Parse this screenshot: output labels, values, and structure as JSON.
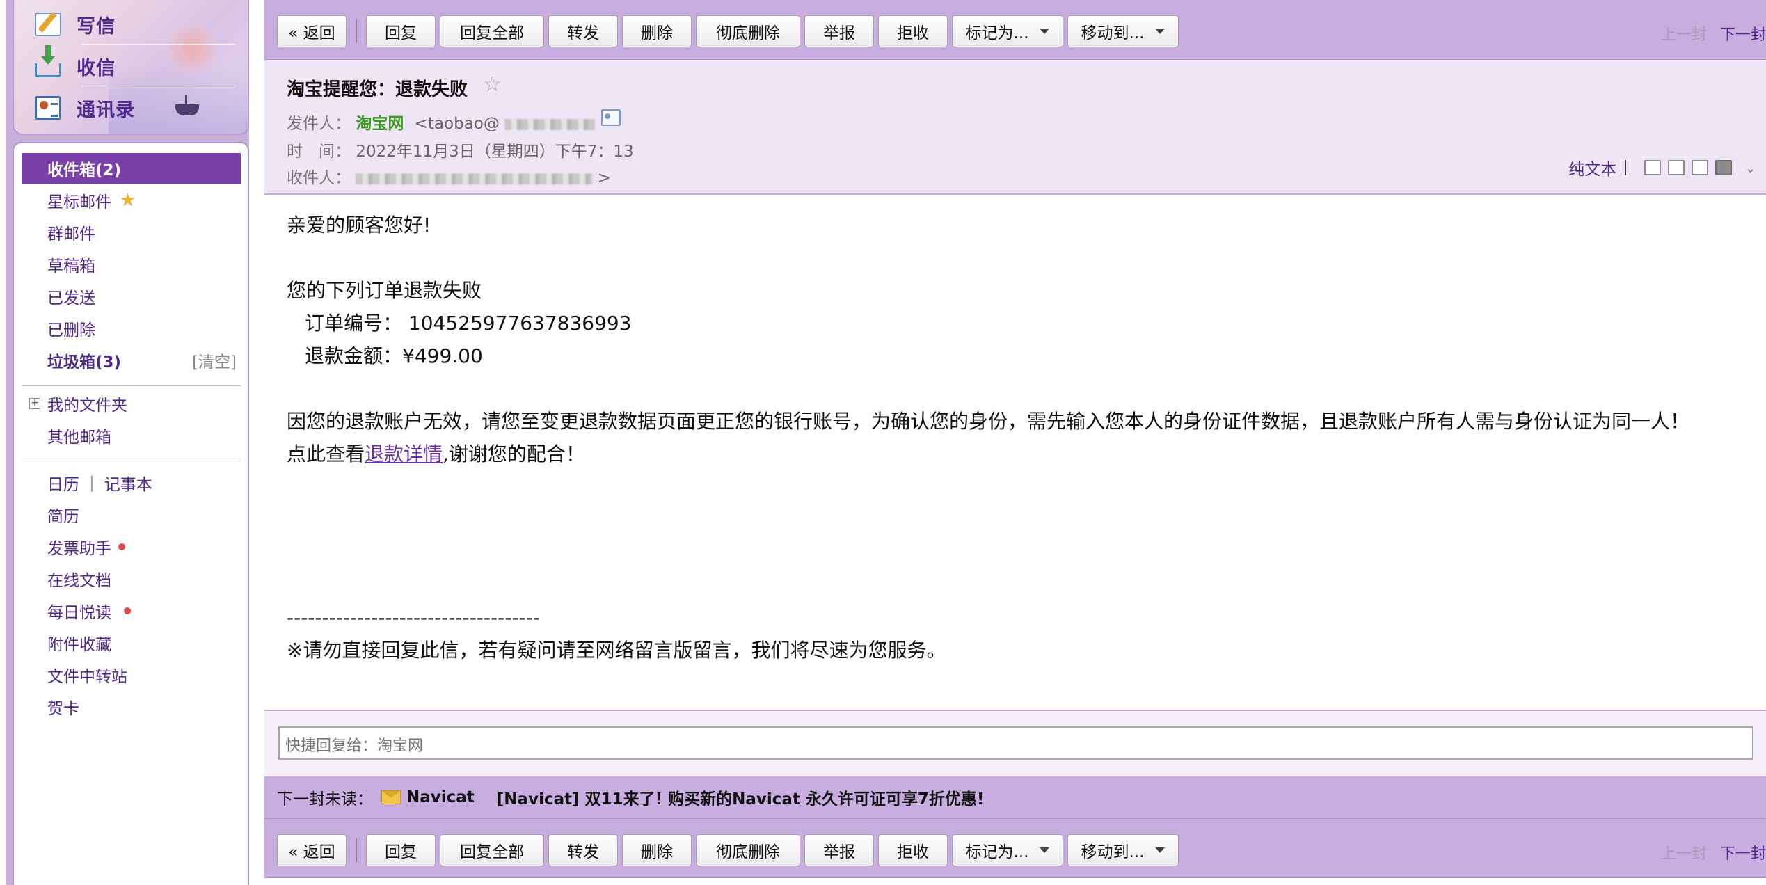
{
  "sidebar": {
    "top_actions": {
      "compose": "写信",
      "receive": "收信",
      "contacts": "通讯录"
    },
    "folders": {
      "inbox": "收件箱(2)",
      "starred": "星标邮件",
      "group": "群邮件",
      "drafts": "草稿箱",
      "sent": "已发送",
      "deleted": "已删除",
      "spam": "垃圾箱(3)",
      "spam_clear": "[清空]",
      "my_folders": "我的文件夹",
      "other_mailboxes": "其他邮箱",
      "calendar": "日历",
      "pipe": "|",
      "notepad": "记事本",
      "resume": "简历",
      "invoice_assistant": "发票助手",
      "online_docs": "在线文档",
      "daily_reading": "每日悦读",
      "attachments": "附件收藏",
      "file_transfer": "文件中转站",
      "cards": "贺卡"
    }
  },
  "toolbar": {
    "back": "« 返回",
    "reply": "回复",
    "reply_all": "回复全部",
    "forward": "转发",
    "delete": "删除",
    "delete_permanent": "彻底删除",
    "report": "举报",
    "reject": "拒收",
    "mark_as": "标记为...",
    "move_to": "移动到...",
    "prev": "上一封",
    "next": "下一封"
  },
  "mail": {
    "subject": "淘宝提醒您：退款失败",
    "star": "☆",
    "from_label": "发件人：",
    "from_name": "淘宝网",
    "from_addr": "<taobao@",
    "time_label": "时　间：",
    "time": "2022年11月3日（星期四）下午7：13",
    "to_label": "收件人：",
    "to_tail": ">",
    "plain_text": "纯文本",
    "body": {
      "greeting": "亲爱的顾客您好!",
      "intro": "您的下列订单退款失败",
      "order_line": "订单编号：  104525977637836993",
      "amount_line": "退款金额：¥499.00",
      "para": "因您的退款账户无效，请您至变更退款数据页面更正您的银行账号，为确认您的身份，需先输入您本人的身份证件数据，且退款账户所有人需与身份认证为同一人！",
      "link_prefix": "点此查看",
      "link_text": "退款详情",
      "link_suffix": ",谢谢您的配合！",
      "dashes": "------------------------------------",
      "footer": "※请勿直接回复此信，若有疑问请至网络留言版留言，我们将尽速为您服务。"
    }
  },
  "quick_reply": {
    "placeholder": "快捷回复给：淘宝网"
  },
  "next_unread": {
    "label": "下一封未读：",
    "from": "Navicat",
    "subject": "[Navicat] 双11来了! 购买新的Navicat 永久许可证可享7折优惠!"
  },
  "colors": {
    "accent": "#7a3fa8",
    "toolbar_bg": "#c8ade0",
    "header_bg": "#efe6f5",
    "link": "#4f2a8a",
    "sender_green": "#3a9a22",
    "unread_dot": "#e04a4a"
  }
}
